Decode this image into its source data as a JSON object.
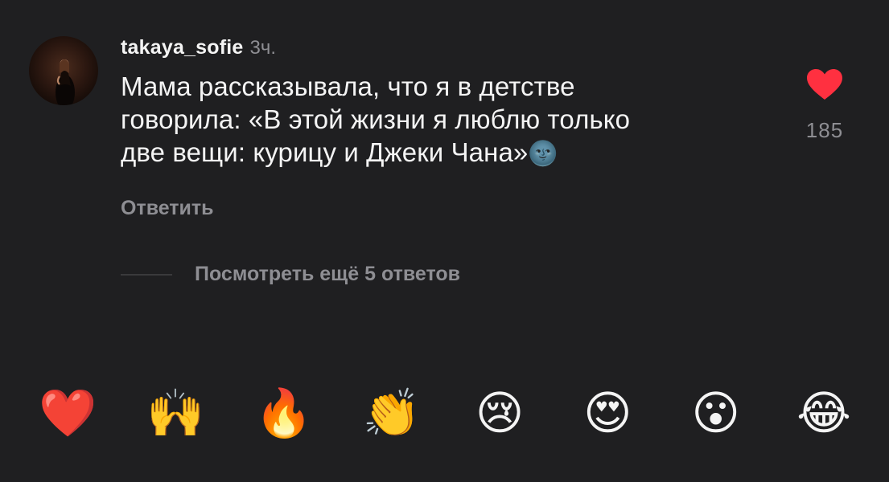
{
  "comment": {
    "username": "takaya_sofie",
    "time": "3ч.",
    "text_lines": [
      "Мама рассказывала, что я в детстве",
      "говорила: «В этой жизни я люблю только",
      "две вещи: курицу и Джеки Чана»"
    ],
    "inline_emoji": "🌚",
    "reply_label": "Ответить",
    "likes": "185",
    "heart_color": "#ff3040"
  },
  "more_replies": {
    "label": "Посмотреть ещё 5 ответов"
  },
  "reactions": [
    {
      "emoji": "❤️",
      "name": "heart"
    },
    {
      "emoji": "🙌",
      "name": "raised-hands"
    },
    {
      "emoji": "🔥",
      "name": "fire"
    },
    {
      "emoji": "👏",
      "name": "clapping"
    },
    {
      "emoji": "😢",
      "name": "crying"
    },
    {
      "emoji": "😍",
      "name": "heart-eyes"
    },
    {
      "emoji": "😮",
      "name": "surprised"
    },
    {
      "emoji": "😂",
      "name": "tears-of-joy"
    }
  ],
  "colors": {
    "background": "#1f1f21",
    "primary_text": "#f4f4f4",
    "secondary_text": "#8e8e93",
    "like_heart": "#ff3040"
  }
}
